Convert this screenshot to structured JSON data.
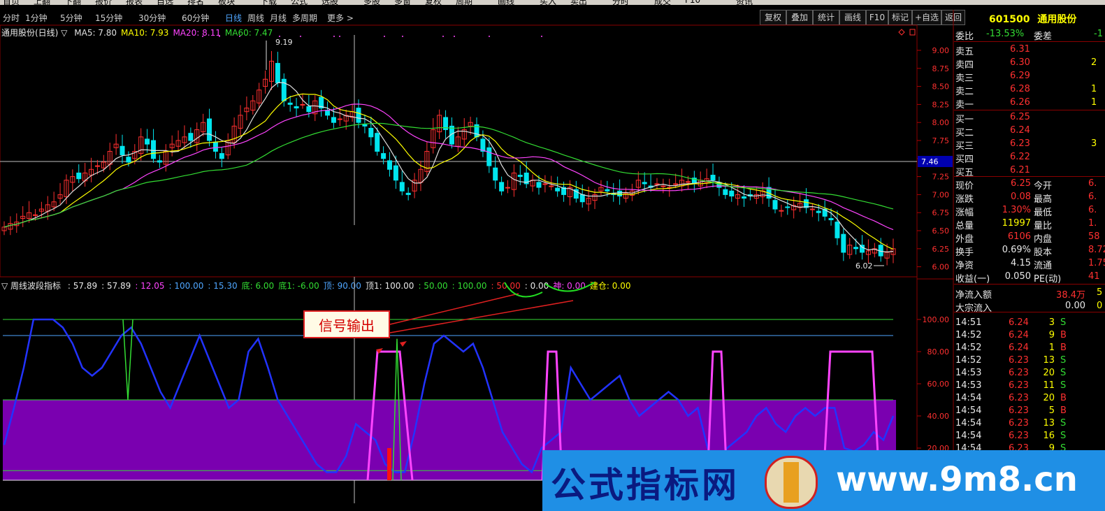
{
  "top_menu": {
    "items": [
      "首页",
      "上翻",
      "下翻",
      "报价",
      "报表",
      "自选",
      "排名",
      "板块",
      "",
      "下载",
      "公式",
      "选股",
      "",
      "多股",
      "多窗",
      "复权",
      "周期",
      "",
      "画线",
      "",
      "买入",
      "卖出",
      "",
      "分时",
      "",
      "成交",
      "F10",
      "",
      "资讯"
    ]
  },
  "periods": {
    "items": [
      "分时",
      "1分钟",
      "5分钟",
      "15分钟",
      "30分钟",
      "60分钟",
      "日线",
      "周线",
      "月线",
      "多周期",
      "更多 >"
    ],
    "active": "日线"
  },
  "toolbar": {
    "buttons": [
      "复权",
      "叠加",
      "统计",
      "画线",
      "F10",
      "标记",
      "+自选",
      "返回"
    ]
  },
  "main_chart": {
    "title": "通用股份(日线) ▽",
    "ma": [
      {
        "label": "MA5: 7.80",
        "color": "#e0e0e0"
      },
      {
        "label": "MA10: 7.93",
        "color": "#ffff00"
      },
      {
        "label": "MA20: 8.11",
        "color": "#ff44ff"
      },
      {
        "label": "MA60: 7.47",
        "color": "#33dd33"
      }
    ],
    "high_label": "9.19",
    "low_label": "6.02",
    "price_marker": "7.46",
    "y_ticks": [
      "9.00",
      "8.75",
      "8.50",
      "8.25",
      "8.00",
      "7.75",
      "7.50",
      "7.25",
      "7.00",
      "6.75",
      "6.50",
      "6.25",
      "6.00"
    ]
  },
  "indicator": {
    "title": "▽ 周线波段指标",
    "values": [
      {
        "t": ": 57.89",
        "c": "#e8e8e8"
      },
      {
        "t": ": 57.89",
        "c": "#e8e8e8"
      },
      {
        "t": ": 12.05",
        "c": "#ff44ff"
      },
      {
        "t": ": 100.00",
        "c": "#4fa6ff"
      },
      {
        "t": ": 15.30",
        "c": "#4fa6ff"
      },
      {
        "t": "底: 6.00",
        "c": "#33dd33"
      },
      {
        "t": "底1: -6.00",
        "c": "#33dd33"
      },
      {
        "t": "顶: 90.00",
        "c": "#4fa6ff"
      },
      {
        "t": "顶1: 100.00",
        "c": "#e8e8e8"
      },
      {
        "t": ": 50.00",
        "c": "#33dd33"
      },
      {
        "t": ": 100.00",
        "c": "#33dd33"
      },
      {
        "t": ": 50.00",
        "c": "#ff3030"
      },
      {
        "t": ": 0.00",
        "c": "#e8e8e8"
      },
      {
        "t": "神: 0.00",
        "c": "#ff44ff"
      },
      {
        "t": "建仓: 0.00",
        "c": "#ffff00"
      }
    ],
    "y_ticks": [
      "100.00",
      "80.00",
      "60.00",
      "40.00",
      "20.00"
    ],
    "callout": "信号输出"
  },
  "right_panel": {
    "code": "601500",
    "name": "通用股份",
    "webi": {
      "label": "委比",
      "value": "-13.53%",
      "diff_label": "委差",
      "diff_value": "-1"
    },
    "asks": [
      {
        "label": "卖五",
        "price": "6.31",
        "vol": ""
      },
      {
        "label": "卖四",
        "price": "6.30",
        "vol": "2"
      },
      {
        "label": "卖三",
        "price": "6.29",
        "vol": ""
      },
      {
        "label": "卖二",
        "price": "6.28",
        "vol": "1"
      },
      {
        "label": "卖一",
        "price": "6.26",
        "vol": "1"
      }
    ],
    "bids": [
      {
        "label": "买一",
        "price": "6.25",
        "vol": ""
      },
      {
        "label": "买二",
        "price": "6.24",
        "vol": ""
      },
      {
        "label": "买三",
        "price": "6.23",
        "vol": "3"
      },
      {
        "label": "买四",
        "price": "6.22",
        "vol": ""
      },
      {
        "label": "买五",
        "price": "6.21",
        "vol": ""
      }
    ],
    "stats": [
      {
        "l1": "现价",
        "v1": "6.25",
        "c1": "#ff3030",
        "l2": "今开",
        "v2": "6."
      },
      {
        "l1": "涨跌",
        "v1": "0.08",
        "c1": "#ff3030",
        "l2": "最高",
        "v2": "6."
      },
      {
        "l1": "涨幅",
        "v1": "1.30%",
        "c1": "#ff3030",
        "l2": "最低",
        "v2": "6."
      },
      {
        "l1": "总量",
        "v1": "11997",
        "c1": "#ffff00",
        "l2": "量比",
        "v2": "1."
      },
      {
        "l1": "外盘",
        "v1": "6106",
        "c1": "#ff3030",
        "l2": "内盘",
        "v2": "58"
      },
      {
        "l1": "换手",
        "v1": "0.69%",
        "c1": "#e8e8e8",
        "l2": "股本",
        "v2": "8.72"
      },
      {
        "l1": "净资",
        "v1": "4.15",
        "c1": "#e8e8e8",
        "l2": "流通",
        "v2": "1.75"
      },
      {
        "l1": "收益(一)",
        "v1": "0.050",
        "c1": "#e8e8e8",
        "l2": "PE(动)",
        "v2": "41"
      }
    ],
    "flow": [
      {
        "label": "净流入额",
        "value": "38.4万",
        "extra": "5"
      },
      {
        "label": "大宗流入",
        "value": "0.00",
        "extra": "0"
      }
    ],
    "ticks": [
      {
        "time": "14:51",
        "price": "6.24",
        "vol": "3",
        "side": "S"
      },
      {
        "time": "14:52",
        "price": "6.24",
        "vol": "9",
        "side": "B"
      },
      {
        "time": "14:52",
        "price": "6.24",
        "vol": "1",
        "side": "B"
      },
      {
        "time": "14:52",
        "price": "6.23",
        "vol": "13",
        "side": "S"
      },
      {
        "time": "14:53",
        "price": "6.23",
        "vol": "20",
        "side": "S"
      },
      {
        "time": "14:53",
        "price": "6.23",
        "vol": "11",
        "side": "S"
      },
      {
        "time": "14:54",
        "price": "6.23",
        "vol": "20",
        "side": "B"
      },
      {
        "time": "14:54",
        "price": "6.23",
        "vol": "5",
        "side": "B"
      },
      {
        "time": "14:54",
        "price": "6.23",
        "vol": "13",
        "side": "S"
      },
      {
        "time": "14:54",
        "price": "6.23",
        "vol": "16",
        "side": "S"
      },
      {
        "time": "14:54",
        "price": "6.23",
        "vol": "9",
        "side": "S"
      }
    ]
  },
  "watermark": {
    "text": "公式指标网",
    "site": "www.9m8.cn"
  },
  "colors": {
    "up": "#ff3030",
    "down": "#00e5ee",
    "ma5": "#e0e0e0",
    "ma10": "#ffff00",
    "ma20": "#ff44ff",
    "ma60": "#33dd33",
    "blue_line": "#2233ff",
    "fill": "#7a00b0"
  }
}
